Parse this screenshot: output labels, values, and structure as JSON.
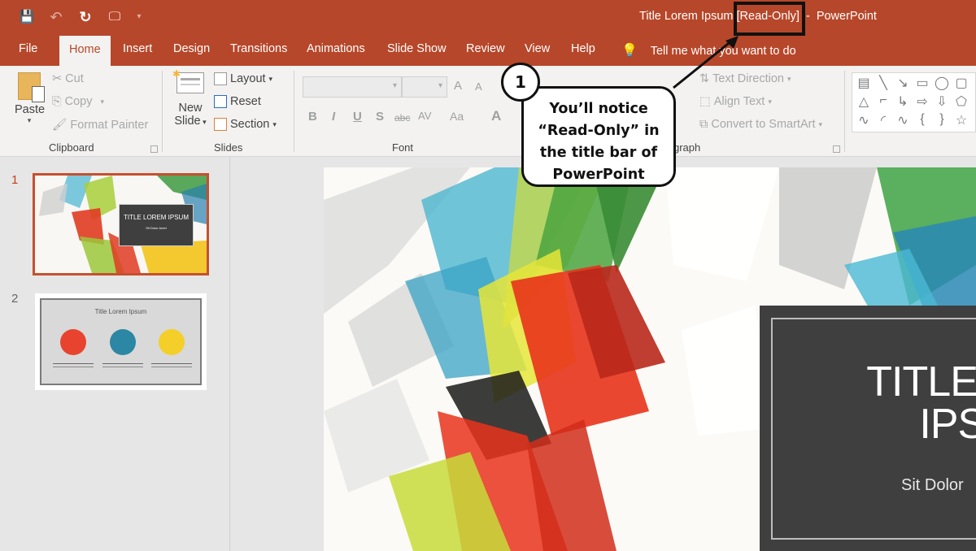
{
  "window": {
    "title_prefix": "Title Lorem Ipsum",
    "title_flag": "[Read-Only]",
    "title_sep": "-",
    "app_name": "PowerPoint"
  },
  "quick_access": [
    {
      "icon": "save-icon",
      "glyph": "💾"
    },
    {
      "icon": "undo-icon",
      "glyph": "↶"
    },
    {
      "icon": "redo-icon",
      "glyph": "↻"
    },
    {
      "icon": "start-slideshow-icon",
      "glyph": "🖵"
    },
    {
      "icon": "customize-qat-icon",
      "glyph": "▾"
    }
  ],
  "tabs": [
    "File",
    "Home",
    "Insert",
    "Design",
    "Transitions",
    "Animations",
    "Slide Show",
    "Review",
    "View",
    "Help"
  ],
  "active_tab": "Home",
  "tell_me": "Tell me what you want to do",
  "ribbon": {
    "clipboard": {
      "paste": "Paste",
      "cut": "Cut",
      "copy": "Copy",
      "format_painter": "Format Painter",
      "label": "Clipboard"
    },
    "slides": {
      "new_slide_1": "New",
      "new_slide_2": "Slide",
      "layout": "Layout",
      "reset": "Reset",
      "section": "Section",
      "label": "Slides"
    },
    "font": {
      "font_name": "",
      "font_size": "",
      "grow": "A",
      "shrink": "A",
      "bold": "B",
      "italic": "I",
      "underline": "U",
      "shadow": "S",
      "strikethrough": "abc",
      "spacing": "AV",
      "change_case": "Aa",
      "color": "A",
      "label": "Font"
    },
    "paragraph": {
      "text_direction": "Text Direction",
      "align_text": "Align Text",
      "convert_smartart": "Convert to SmartArt",
      "label": "Paragraph",
      "label_visible": "graph"
    },
    "shapes": [
      "▤",
      "╲",
      "↘",
      "▭",
      "◯",
      "▢",
      "△",
      "⌐",
      "↳",
      "⇨",
      "⇩",
      "⬠",
      "∿",
      "◜",
      "∿",
      "{",
      "}",
      "☆"
    ]
  },
  "slides_panel": [
    {
      "number": "1",
      "title": "TITLE LOREM IPSUM",
      "subtitle": "Sit Dolor Amet",
      "selected": true
    },
    {
      "number": "2",
      "title": "Title Lorem Ipsum",
      "selected": false,
      "circles": [
        {
          "color": "#e8432f"
        },
        {
          "color": "#2b87a3"
        },
        {
          "color": "#f4cf2a"
        }
      ]
    }
  ],
  "current_slide": {
    "title_line1": "TITLE LO",
    "title_line2": "IPSU",
    "subtitle": "Sit Dolor"
  },
  "annotation": {
    "number": "1",
    "text_1": "You’ll notice",
    "text_2": "“Read-Only” in",
    "text_3": "the title bar of",
    "text_4": "PowerPoint"
  },
  "colors": {
    "accent": "#b7472a",
    "ribbon_bg": "#f3f2f1",
    "selected_thumb_border": "#c6502e"
  }
}
